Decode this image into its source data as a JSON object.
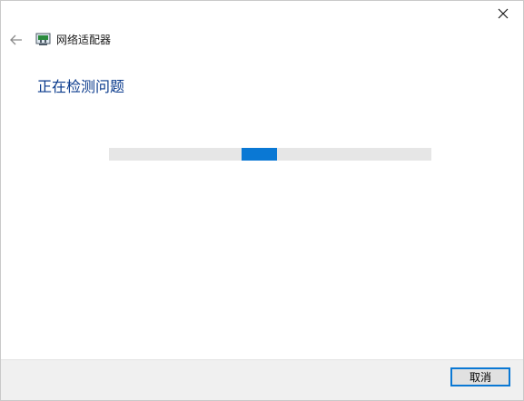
{
  "window": {
    "title": "网络适配器"
  },
  "main": {
    "heading": "正在检测问题"
  },
  "progress": {
    "style": "indeterminate",
    "marquee_segment_start_fraction": 0.41,
    "marquee_segment_length_fraction": 0.11
  },
  "footer": {
    "cancel_label": "取消"
  },
  "colors": {
    "heading": "#0a3a8c",
    "accent": "#0a78d4",
    "track": "#e6e6e6",
    "footer_bg": "#f0f0f0"
  },
  "icons": {
    "back": "back-arrow-icon",
    "close": "close-icon",
    "app": "network-adapter-icon"
  }
}
